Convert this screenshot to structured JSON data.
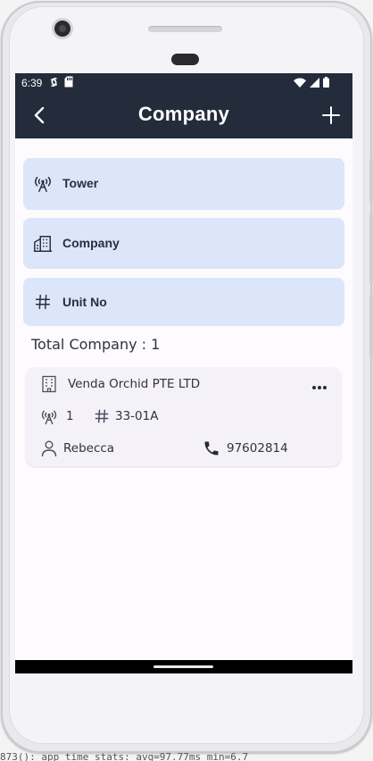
{
  "status_bar": {
    "time": "6:39"
  },
  "app_bar": {
    "title": "Company",
    "back_icon": "arrow-back-icon",
    "add_icon": "plus-icon"
  },
  "filters": [
    {
      "label": "Tower",
      "icon": "antenna-icon"
    },
    {
      "label": "Company",
      "icon": "building-icon"
    },
    {
      "label": "Unit No",
      "icon": "hash-icon"
    }
  ],
  "summary": {
    "total_text": "Total Company : 1"
  },
  "companies": [
    {
      "name": "Venda Orchid PTE LTD",
      "tower": "1",
      "unit": "33-01A",
      "contact": "Rebecca",
      "phone": "97602814"
    }
  ],
  "bottom_text": "873(): app_time_stats: avg=97.77ms min=6.7",
  "colors": {
    "app_bar": "#242c3b",
    "filter_bg": "#dbe6fb",
    "card_bg": "#f4f1f8",
    "screen_bg": "#fdfbfe"
  }
}
